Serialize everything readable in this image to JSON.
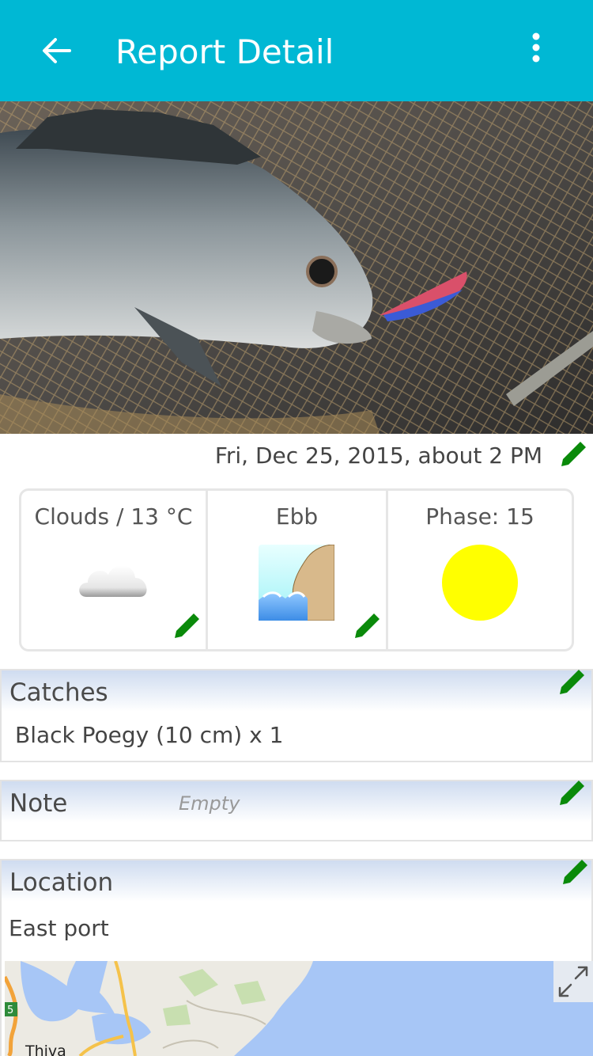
{
  "app_bar": {
    "title": "Report Detail",
    "back_icon": "arrow-left-icon",
    "menu_icon": "more-vert-icon",
    "background": "#00b8d4"
  },
  "report": {
    "date": "Fri, Dec 25, 2015, about 2 PM"
  },
  "conditions": {
    "weather": {
      "label": "Clouds / 13 °C",
      "icon": "cloud-icon"
    },
    "tide": {
      "label": "Ebb",
      "icon": "ebb-tide-icon"
    },
    "moon": {
      "label": "Phase: 15",
      "icon": "full-moon-icon",
      "color": "#ffff00"
    }
  },
  "catches": {
    "title": "Catches",
    "items": [
      "Black Poegy (10 cm) x 1"
    ]
  },
  "note": {
    "title": "Note",
    "placeholder": "Empty"
  },
  "location": {
    "title": "Location",
    "name": "East port",
    "map_labels": [
      "Thiva",
      "5"
    ],
    "expand_icon": "expand-icon"
  },
  "colors": {
    "edit": "#0a8a0a",
    "accent": "#00b8d4"
  }
}
